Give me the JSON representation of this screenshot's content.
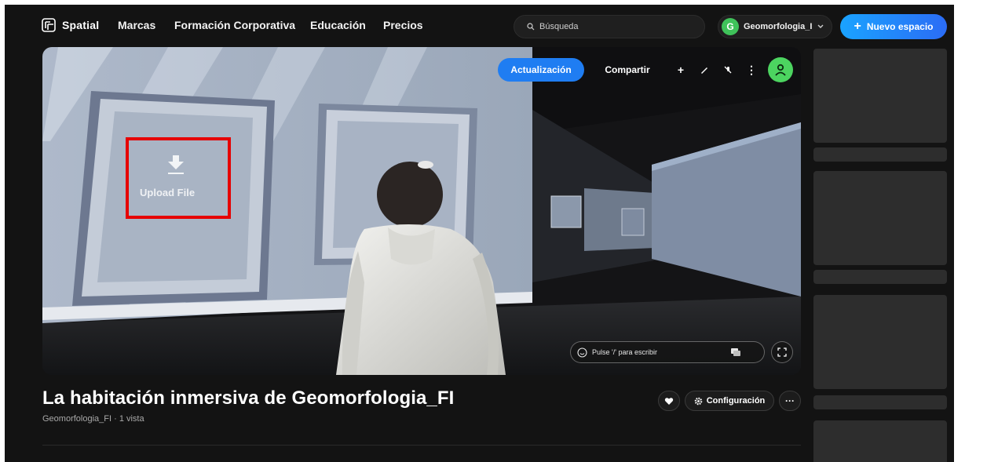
{
  "nav": {
    "logo_text": "Spatial",
    "links": [
      "Marcas",
      "Formación Corporativa",
      "Educación",
      "Precios"
    ],
    "search_placeholder": "Búsqueda",
    "user_initial": "G",
    "user_name": "Geomorfologia_I",
    "new_space_label": "Nuevo espacio"
  },
  "viewport": {
    "update_label": "Actualización",
    "share_label": "Compartir",
    "upload_label": "Upload File",
    "chat_placeholder": "Pulse '/' para escribir",
    "highlight_color": "#e60000"
  },
  "space": {
    "title": "La habitación inmersiva de Geomorfologia_FI",
    "meta": "Geomorfologia_FI · 1 vista",
    "config_label": "Configuración"
  },
  "colors": {
    "accent": "#1f7df2",
    "avatar_green": "#3fc25a",
    "background": "#131313"
  }
}
